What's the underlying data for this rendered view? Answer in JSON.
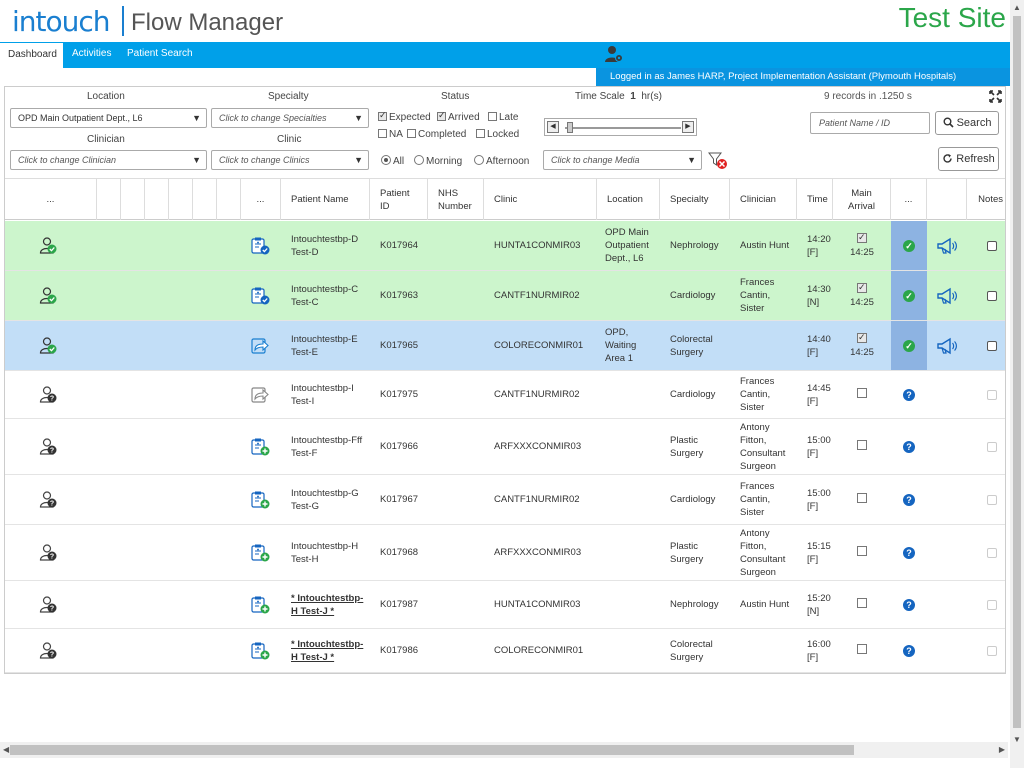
{
  "header": {
    "brand": "intouch",
    "product": "Flow Manager",
    "site_label": "Test Site"
  },
  "nav": {
    "tabs": [
      {
        "label": "Dashboard",
        "active": true
      },
      {
        "label": "Activities"
      },
      {
        "label": "Patient Search"
      }
    ]
  },
  "user": {
    "logged_in_text": "Logged in as James HARP, Project Implementation Assistant (Plymouth Hospitals)"
  },
  "filters": {
    "location_label": "Location",
    "location_value": "OPD Main Outpatient Dept., L6",
    "specialty_label": "Specialty",
    "specialty_placeholder": "Click to change Specialties",
    "clinician_label": "Clinician",
    "clinician_placeholder": "Click to change Clinician",
    "clinic_label": "Clinic",
    "clinic_placeholder": "Click to change Clinics",
    "status_label": "Status",
    "status_options": [
      {
        "label": "Expected",
        "checked": true
      },
      {
        "label": "Arrived",
        "checked": true
      },
      {
        "label": "Late",
        "checked": false
      },
      {
        "label": "NA",
        "checked": false
      },
      {
        "label": "Completed",
        "checked": false
      },
      {
        "label": "Locked",
        "checked": false
      }
    ],
    "time_scale_label": "Time Scale",
    "time_scale_value": "1",
    "time_scale_unit": "hr(s)",
    "records_text": "9 records in .1250 s",
    "period_options": [
      {
        "label": "All",
        "selected": true
      },
      {
        "label": "Morning"
      },
      {
        "label": "Afternoon"
      }
    ],
    "media_placeholder": "Click to change Media",
    "search_placeholder": "Patient Name / ID",
    "search_label": "Search",
    "refresh_label": "Refresh"
  },
  "table": {
    "headers": {
      "col1": "...",
      "col2": "...",
      "patient_name": "Patient Name",
      "patient_id": "Patient ID",
      "nhs_number": "NHS Number",
      "clinic": "Clinic",
      "location": "Location",
      "specialty": "Specialty",
      "clinician": "Clinician",
      "time": "Time",
      "main_arrival": "Main Arrival",
      "status": "...",
      "notes": "Notes"
    },
    "rows": [
      {
        "bg": "#ccf5cc",
        "person": "green",
        "action": "clipboard-check",
        "name": "Intouchtestbp-D Test-D",
        "id": "K017964",
        "clinic": "HUNTA1CONMIR03",
        "location": "OPD Main Outpatient Dept., L6",
        "specialty": "Nephrology",
        "clinician": "Austin Hunt",
        "time": "14:20 [F]",
        "arrived": true,
        "arrival_time": "14:25",
        "status": "ok",
        "callout": true,
        "bold": false
      },
      {
        "bg": "#ccf5cc",
        "person": "green",
        "action": "clipboard-check",
        "name": "Intouchtestbp-C Test-C",
        "id": "K017963",
        "clinic": "CANTF1NURMIR02",
        "location": "",
        "specialty": "Cardiology",
        "clinician": "Frances Cantin, Sister",
        "time": "14:30 [N]",
        "arrived": true,
        "arrival_time": "14:25",
        "status": "ok",
        "callout": true,
        "bold": false
      },
      {
        "bg": "#c2def7",
        "person": "green",
        "action": "forward",
        "name": "Intouchtestbp-E Test-E",
        "id": "K017965",
        "clinic": "COLORECONMIR01",
        "location": "OPD, Waiting Area 1",
        "specialty": "Colorectal Surgery",
        "clinician": "",
        "time": "14:40 [F]",
        "arrived": true,
        "arrival_time": "14:25",
        "status": "ok",
        "callout": true,
        "bold": false
      },
      {
        "bg": "#ffffff",
        "person": "grey",
        "action": "forward-grey",
        "name": "Intouchtestbp-I Test-I",
        "id": "K017975",
        "clinic": "CANTF1NURMIR02",
        "location": "",
        "specialty": "Cardiology",
        "clinician": "Frances Cantin, Sister",
        "time": "14:45 [F]",
        "arrived": false,
        "arrival_time": "",
        "status": "unknown",
        "callout": false,
        "bold": false
      },
      {
        "bg": "#ffffff",
        "person": "grey",
        "action": "clipboard-add",
        "name": "Intouchtestbp-Fff Test-F",
        "id": "K017966",
        "clinic": "ARFXXXCONMIR03",
        "location": "",
        "specialty": "Plastic Surgery",
        "clinician": "Antony Fitton, Consultant Surgeon",
        "time": "15:00 [F]",
        "arrived": false,
        "arrival_time": "",
        "status": "unknown",
        "callout": false,
        "bold": false
      },
      {
        "bg": "#ffffff",
        "person": "grey",
        "action": "clipboard-add",
        "name": "Intouchtestbp-G Test-G",
        "id": "K017967",
        "clinic": "CANTF1NURMIR02",
        "location": "",
        "specialty": "Cardiology",
        "clinician": "Frances Cantin, Sister",
        "time": "15:00 [F]",
        "arrived": false,
        "arrival_time": "",
        "status": "unknown",
        "callout": false,
        "bold": false
      },
      {
        "bg": "#ffffff",
        "person": "grey",
        "action": "clipboard-add",
        "name": "Intouchtestbp-H Test-H",
        "id": "K017968",
        "clinic": "ARFXXXCONMIR03",
        "location": "",
        "specialty": "Plastic Surgery",
        "clinician": "Antony Fitton, Consultant Surgeon",
        "time": "15:15 [F]",
        "arrived": false,
        "arrival_time": "",
        "status": "unknown",
        "callout": false,
        "bold": false
      },
      {
        "bg": "#ffffff",
        "person": "grey",
        "action": "clipboard-add",
        "name": "* Intouchtestbp-H Test-J *",
        "id": "K017987",
        "clinic": "HUNTA1CONMIR03",
        "location": "",
        "specialty": "Nephrology",
        "clinician": "Austin Hunt",
        "time": "15:20 [N]",
        "arrived": false,
        "arrival_time": "",
        "status": "unknown",
        "callout": false,
        "bold": true
      },
      {
        "bg": "#ffffff",
        "person": "grey",
        "action": "clipboard-add",
        "name": "* Intouchtestbp-H Test-J *",
        "id": "K017986",
        "clinic": "COLORECONMIR01",
        "location": "",
        "specialty": "Colorectal Surgery",
        "clinician": "",
        "time": "16:00 [F]",
        "arrived": false,
        "arrival_time": "",
        "status": "unknown",
        "callout": false,
        "bold": true
      }
    ]
  }
}
